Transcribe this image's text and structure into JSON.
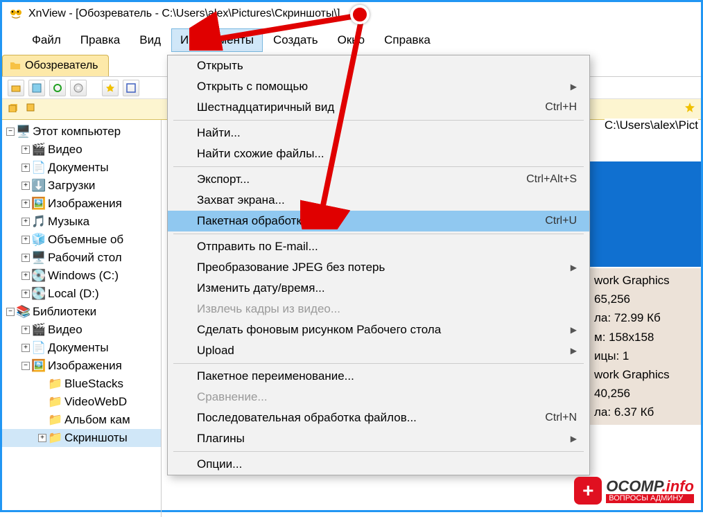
{
  "window_title": "XnView - [Обозреватель - C:\\Users\\alex\\Pictures\\Скриншоты\\]",
  "menubar": {
    "file": "Файл",
    "edit": "Правка",
    "view": "Вид",
    "tools": "Инструменты",
    "create": "Создать",
    "window": "Окно",
    "help": "Справка"
  },
  "tab": {
    "label": "Обозреватель"
  },
  "path_field": "C:\\Users\\alex\\Pict",
  "dropdown": {
    "open": "Открыть",
    "open_with": "Открыть с помощью",
    "hex_view": "Шестнадцатиричный вид",
    "hex_view_sc": "Ctrl+H",
    "find": "Найти...",
    "find_similar": "Найти схожие файлы...",
    "export": "Экспорт...",
    "export_sc": "Ctrl+Alt+S",
    "screen_capture": "Захват экрана...",
    "batch_processing": "Пакетная обработка...",
    "batch_processing_sc": "Ctrl+U",
    "send_email": "Отправить по E-mail...",
    "jpeg_lossless": "Преобразование JPEG без потерь",
    "change_datetime": "Изменить дату/время...",
    "extract_video": "Извлечь кадры из видео...",
    "set_wallpaper": "Сделать фоновым рисунком Рабочего стола",
    "upload": "Upload",
    "batch_rename": "Пакетное переименование...",
    "compare": "Сравнение...",
    "sequential_processing": "Последовательная обработка файлов...",
    "sequential_processing_sc": "Ctrl+N",
    "plugins": "Плагины",
    "options": "Опции..."
  },
  "tree": {
    "this_pc": "Этот компьютер",
    "video": "Видео",
    "documents": "Документы",
    "downloads": "Загрузки",
    "pictures": "Изображения",
    "music": "Музыка",
    "objects3d": "Объемные об",
    "desktop": "Рабочий стол",
    "windows_c": "Windows (C:)",
    "local_d": "Local (D:)",
    "libraries": "Библиотеки",
    "lib_video": "Видео",
    "lib_documents": "Документы",
    "lib_pictures": "Изображения",
    "bluestacks": "BlueStacks",
    "videowebd": "VideoWebD",
    "album_cam": "Альбом кам",
    "screenshots": "Скриншоты"
  },
  "info_panel": {
    "l1": "work Graphics",
    "l2": "65,256",
    "l3": "ла: 72.99 Кб",
    "l4": "м: 158x158",
    "l5": "ицы: 1",
    "l6": "work Graphics",
    "l7": "40,256",
    "l8": "ла: 6.37 Кб"
  },
  "watermark": {
    "brand": "OCOMP",
    "tld": ".info",
    "tagline": "ВОПРОСЫ АДМИНУ"
  }
}
